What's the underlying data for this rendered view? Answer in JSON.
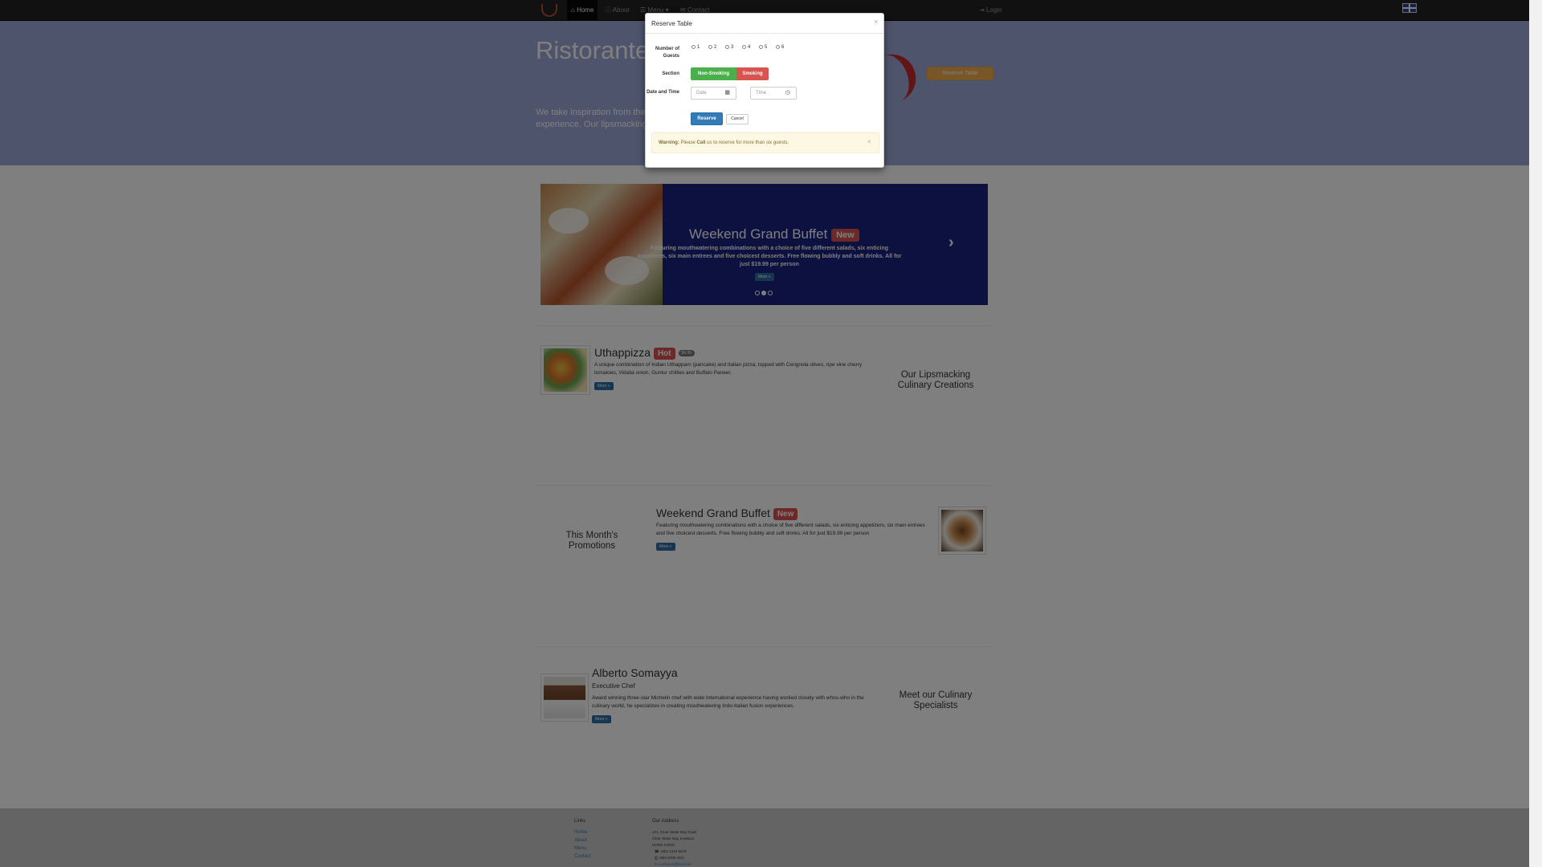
{
  "nav": {
    "items": [
      {
        "label": "Home",
        "icon": "home-icon"
      },
      {
        "label": "About",
        "icon": "info-icon"
      },
      {
        "label": "Menu",
        "icon": "list-icon"
      },
      {
        "label": "Contact",
        "icon": "envelope-icon"
      }
    ],
    "login": "Login"
  },
  "jumbotron": {
    "title": "Ristorante",
    "text": "We take inspiration from the experience. Our lipsmacking",
    "reserve_button": "Reserve Table"
  },
  "carousel": {
    "title": "Weekend Grand Buffet",
    "badge": "New",
    "description": "Featuring mouthwatering combinations with a choice of five different salads, six enticing appetizers, six main entrees and five choicest desserts. Free flowing bubbly and soft drinks. All for just $19.99 per person",
    "more_button": "More »",
    "active_slide": 2,
    "slide_count": 3
  },
  "dish": {
    "name": "Uthappizza",
    "label": "Hot",
    "price": "$4.99",
    "description": "A unique combination of Indian Uthappam (pancake) and Italian pizza, topped with Cerignola olives, ripe vine cherry tomatoes, Vidalia onion, Guntur chillies and Buffalo Paneer.",
    "more_button": "More »",
    "side_heading": "Our Lipsmacking Culinary Creations"
  },
  "promotion": {
    "side_heading": "This Month's Promotions",
    "name": "Weekend Grand Buffet",
    "label": "New",
    "description": "Featuring mouthwatering combinations with a choice of five different salads, six enticing appetizers, six main entrees and five choicest desserts. Free flowing bubbly and soft drinks. All for just $19.99 per person",
    "more_button": "More »"
  },
  "leader": {
    "name": "Alberto Somayya",
    "designation": "Executive Chef",
    "description": "Award winning three-star Michelin chef with wide International experience having worked closely with whos-who in the culinary world, he specializes in creating mouthwatering Indo-Italian fusion experiences.",
    "more_button": "More »",
    "side_heading": "Meet our Culinary Specialists"
  },
  "footer": {
    "links_heading": "Links",
    "links": [
      "Home",
      "About",
      "Menu",
      "Contact"
    ],
    "address_heading": "Our Address",
    "address_lines": [
      "121, Clear Water Bay Road",
      "Clear Water Bay, Kowloon",
      "HONG KONG",
      "+852 1234 5678",
      "+852 8765 4321",
      "confusion@food.net"
    ]
  },
  "modal": {
    "title": "Reserve Table",
    "close": "×",
    "guests_label": "Number of Guests",
    "guest_options": [
      "1",
      "2",
      "3",
      "4",
      "5",
      "6"
    ],
    "section_label": "Section",
    "section_options": [
      "Non-Smoking",
      "Smoking"
    ],
    "datetime_label": "Date and Time",
    "date_placeholder": "Date",
    "time_placeholder": "Time",
    "reserve_button": "Reserve",
    "cancel_button": "Cancel",
    "warning_strong": "Warning:",
    "warning_text": " Please ",
    "warning_call": "Call",
    "warning_rest": " us to reserve for more than six guests."
  }
}
